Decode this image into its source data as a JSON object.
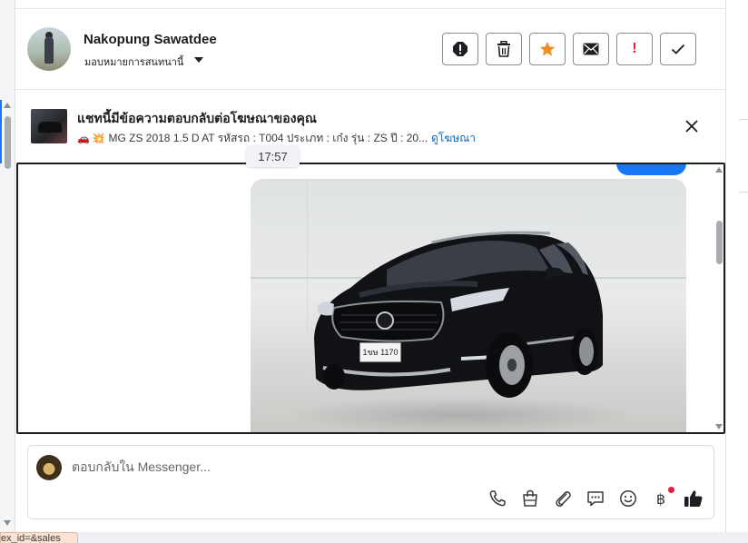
{
  "header": {
    "contact_name": "Nakopung Sawatdee",
    "assign_label": "มอบหมายการสนทนานี้",
    "actions": [
      {
        "name": "report-icon",
        "color": "#1c1e21"
      },
      {
        "name": "trash-icon",
        "color": "#1c1e21"
      },
      {
        "name": "star-icon",
        "color": "#f28c28"
      },
      {
        "name": "mail-icon",
        "color": "#1c1e21"
      },
      {
        "name": "exclamation-icon",
        "color": "#e41e3f"
      },
      {
        "name": "check-icon",
        "color": "#1c1e21"
      }
    ],
    "important_mark": "!"
  },
  "ad_banner": {
    "title": "แชทนี้มีข้อความตอบกลับต่อโฆษณาของคุณ",
    "emoji": "🚗 💥",
    "description": "MG ZS 2018 1.5 D AT รหัสรถ : T004 ประเภท : เก๋ง รุ่น : ZS ปี : 20...",
    "link_label": "ดูโฆษณา"
  },
  "conversation": {
    "timestamp": "17:57",
    "plate_text": "1ขษ 1170"
  },
  "reply": {
    "placeholder": "ตอบกลับใน Messenger...",
    "currency_symbol": "฿",
    "tools": [
      "phone-icon",
      "shopping-bag-icon",
      "paperclip-icon",
      "chat-bubble-icon",
      "emoji-icon",
      "baht-icon",
      "thumbs-up-icon"
    ],
    "notification_dot_color": "#e41e3f",
    "accent_color": "#1877f2"
  },
  "bottom_tab": {
    "label": "ex_id=&sales"
  }
}
